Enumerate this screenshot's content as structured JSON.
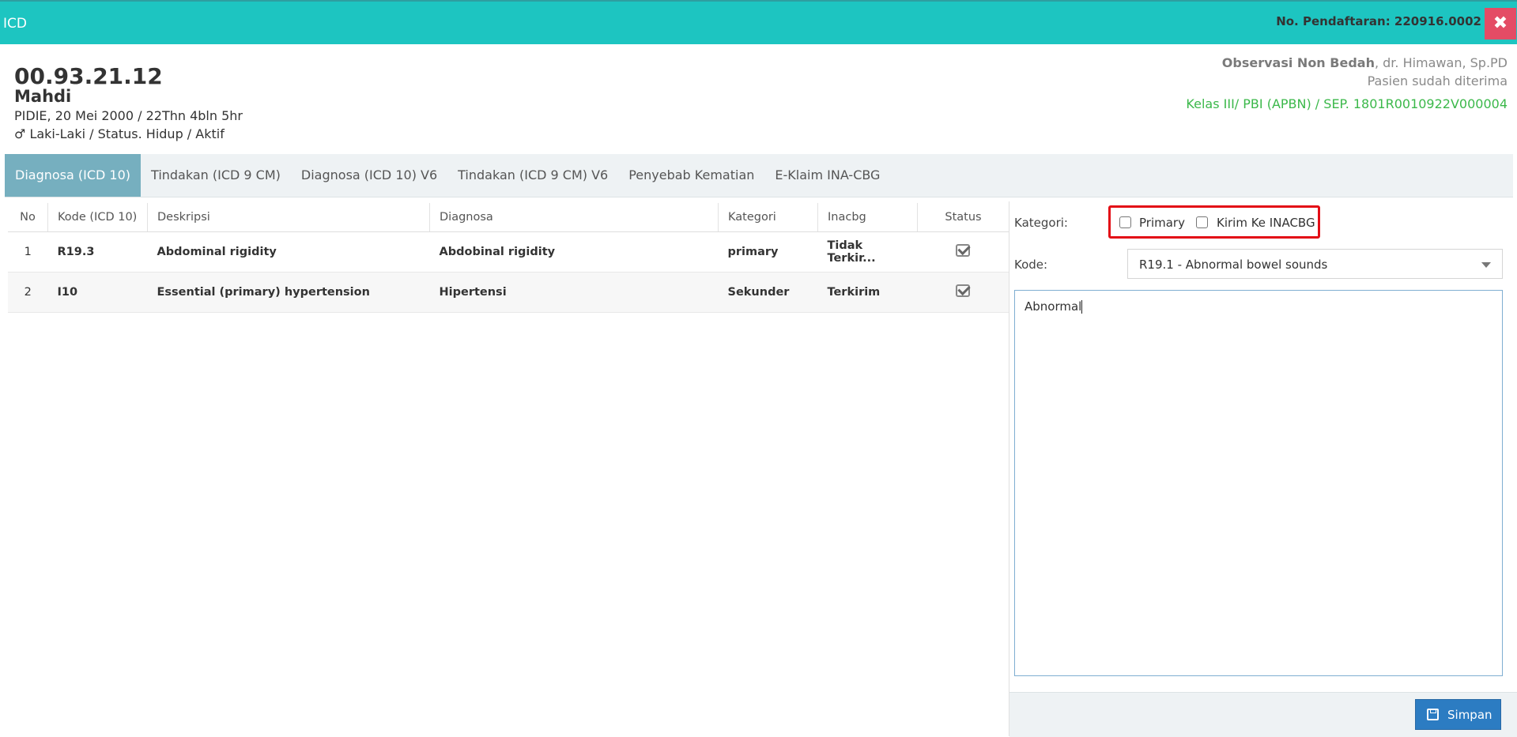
{
  "header": {
    "title": "ICD",
    "no_pendaftaran": "No. Pendaftaran: 220916.0002",
    "close_glyph": "✖"
  },
  "patient": {
    "rm": "00.93.21.12",
    "name": "Mahdi",
    "birth": "PIDIE, 20 Mei 2000 / 22Thn 4bln 5hr",
    "gender_icon": "male-icon",
    "gender_glyph": "♂",
    "status_line": "Laki-Laki / Status. Hidup / Aktif"
  },
  "visit": {
    "unit": "Observasi Non Bedah",
    "doctor": ", dr. Himawan, Sp.PD",
    "status": "Pasien sudah diterima",
    "kelas": "Kelas III/ PBI (APBN) / SEP. 1801R0010922V000004"
  },
  "tabs": [
    {
      "label": "Diagnosa (ICD 10)",
      "active": true
    },
    {
      "label": "Tindakan (ICD 9 CM)",
      "active": false
    },
    {
      "label": "Diagnosa (ICD 10) V6",
      "active": false
    },
    {
      "label": "Tindakan (ICD 9 CM) V6",
      "active": false
    },
    {
      "label": "Penyebab Kematian",
      "active": false
    },
    {
      "label": "E-Klaim INA-CBG",
      "active": false
    }
  ],
  "table": {
    "headers": [
      "No",
      "Kode (ICD 10)",
      "Deskripsi",
      "Diagnosa",
      "Kategori",
      "Inacbg",
      "Status"
    ],
    "rows": [
      {
        "no": "1",
        "kode": "R19.3",
        "deskripsi": "Abdominal rigidity",
        "diagnosa": "Abdobinal rigidity",
        "kategori": "primary",
        "inacbg": "Tidak Terkir...",
        "status_icon": "check-square-icon"
      },
      {
        "no": "2",
        "kode": "I10",
        "deskripsi": "Essential (primary) hypertension",
        "diagnosa": "Hipertensi",
        "kategori": "Sekunder",
        "inacbg": "Terkirim",
        "status_icon": "check-square-icon"
      }
    ]
  },
  "form": {
    "kategori_label": "Kategori:",
    "primary_label": "Primary",
    "kirim_label": "Kirim Ke INACBG",
    "primary_checked": false,
    "kirim_checked": false,
    "kode_label": "Kode:",
    "kode_value": "R19.1 - Abnormal bowel sounds",
    "text_value": "Abnormal",
    "save_label": "Simpan",
    "save_icon": "save-icon"
  },
  "colors": {
    "header_bg": "#1dc5c1",
    "close_bg": "#e44c65",
    "tab_active_bg": "#76afbf",
    "kelas_text": "#3bb84a",
    "highlight_border": "#e30d16",
    "save_bg": "#2c7cc2"
  }
}
